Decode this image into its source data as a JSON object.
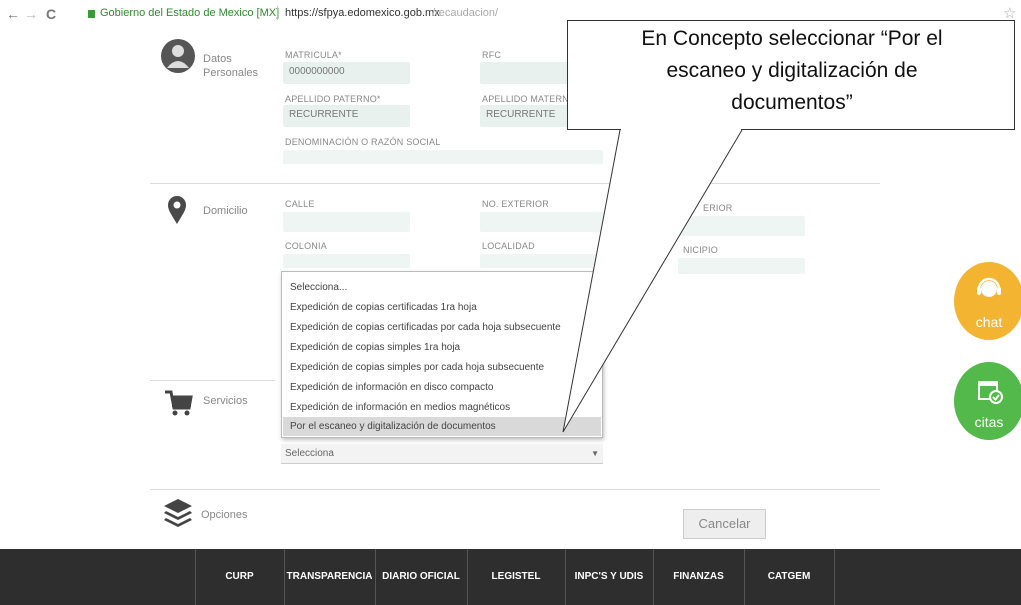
{
  "browser": {
    "back": "←",
    "forward": "→",
    "reload": "C",
    "site_name": "Gobierno del Estado de Mexico [MX]",
    "url_host": "https://sfpya.edomexico.gob.mx",
    "url_path": "/recaudacion/",
    "star": "☆"
  },
  "sections": {
    "datos": {
      "title_1": "Datos",
      "title_2": "Personales"
    },
    "domicilio": {
      "title": "Domicilio"
    },
    "servicios": {
      "title": "Servicios"
    },
    "opciones": {
      "title": "Opciones"
    }
  },
  "form": {
    "matricula_label": "MATRICULA*",
    "matricula_value": "0000000000",
    "rfc_label": "RFC",
    "ap_paterno_label": "APELLIDO PATERNO*",
    "ap_paterno_value": "RECURRENTE",
    "ap_materno_label": "APELLIDO MATERNO",
    "ap_materno_value": "RECURRENTE",
    "razon_social_label": "DENOMINACIÓN O RAZÓN SOCIAL",
    "calle_label": "CALLE",
    "no_exterior_label": "NO. EXTERIOR",
    "no_interior_label": "ERIOR",
    "colonia_label": "COLONIA",
    "localidad_label": "LOCALIDAD",
    "municipio_label": "NICIPIO"
  },
  "concepto_dropdown": {
    "options": [
      "Selecciona...",
      "Expedición de copias certificadas 1ra hoja",
      "Expedición de copias certificadas por cada hoja subsecuente",
      "Expedición de copias simples 1ra hoja",
      "Expedición de copias simples por cada hoja subsecuente",
      "Expedición de información en disco compacto",
      "Expedición de información en medios magnéticos",
      "Por el escaneo y digitalización de documentos"
    ],
    "highlighted_index": 7,
    "current_value": "Selecciona"
  },
  "buttons": {
    "cancel": "Cancelar"
  },
  "floating": {
    "chat": "chat",
    "citas": "citas",
    "chat_color": "#f2b431",
    "citas_color": "#53b94a"
  },
  "callout": {
    "line1": "En Concepto seleccionar “Por el",
    "line2": "escaneo y digitalización de",
    "line3": "documentos”"
  },
  "footer": {
    "items": [
      "CURP",
      "TRANSPARENCIA",
      "DIARIO OFICIAL",
      "LEGISTEL",
      "INPC'S Y UDIS",
      "FINANZAS",
      "CATGEM"
    ]
  }
}
